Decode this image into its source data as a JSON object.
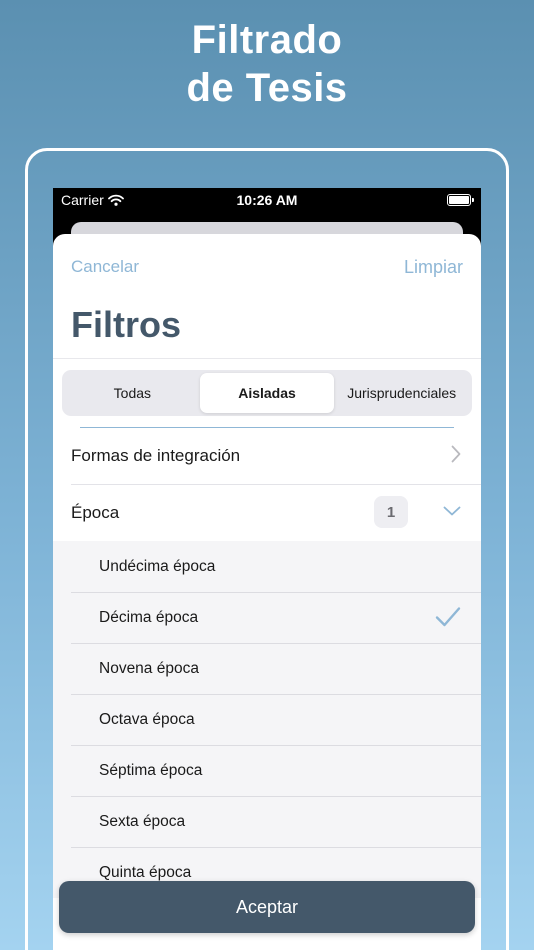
{
  "headline": {
    "line1": "Filtrado",
    "line2": "de Tesis"
  },
  "status_bar": {
    "carrier": "Carrier",
    "time": "10:26 AM"
  },
  "nav": {
    "cancel_label": "Cancelar",
    "clear_label": "Limpiar"
  },
  "title": "Filtros",
  "segments": [
    "Todas",
    "Aisladas",
    "Jurisprudenciales"
  ],
  "selected_segment": "Aisladas",
  "rows": {
    "integration": {
      "label": "Formas de integración"
    },
    "epoch": {
      "label": "Época",
      "badge": "1"
    }
  },
  "epochs": [
    {
      "label": "Undécima época",
      "checked": false
    },
    {
      "label": "Décima época",
      "checked": true
    },
    {
      "label": "Novena época",
      "checked": false
    },
    {
      "label": "Octava época",
      "checked": false
    },
    {
      "label": "Séptima época",
      "checked": false
    },
    {
      "label": "Sexta época",
      "checked": false
    },
    {
      "label": "Quinta época",
      "checked": false
    }
  ],
  "accept_label": "Aceptar",
  "colors": {
    "accent": "#8fb7d6",
    "primary": "#44586a"
  },
  "icons": {
    "wifi": "wifi-icon",
    "battery": "battery-icon",
    "chevron_right": "chevron-right-icon",
    "chevron_down": "chevron-down-icon",
    "check": "checkmark-icon"
  }
}
